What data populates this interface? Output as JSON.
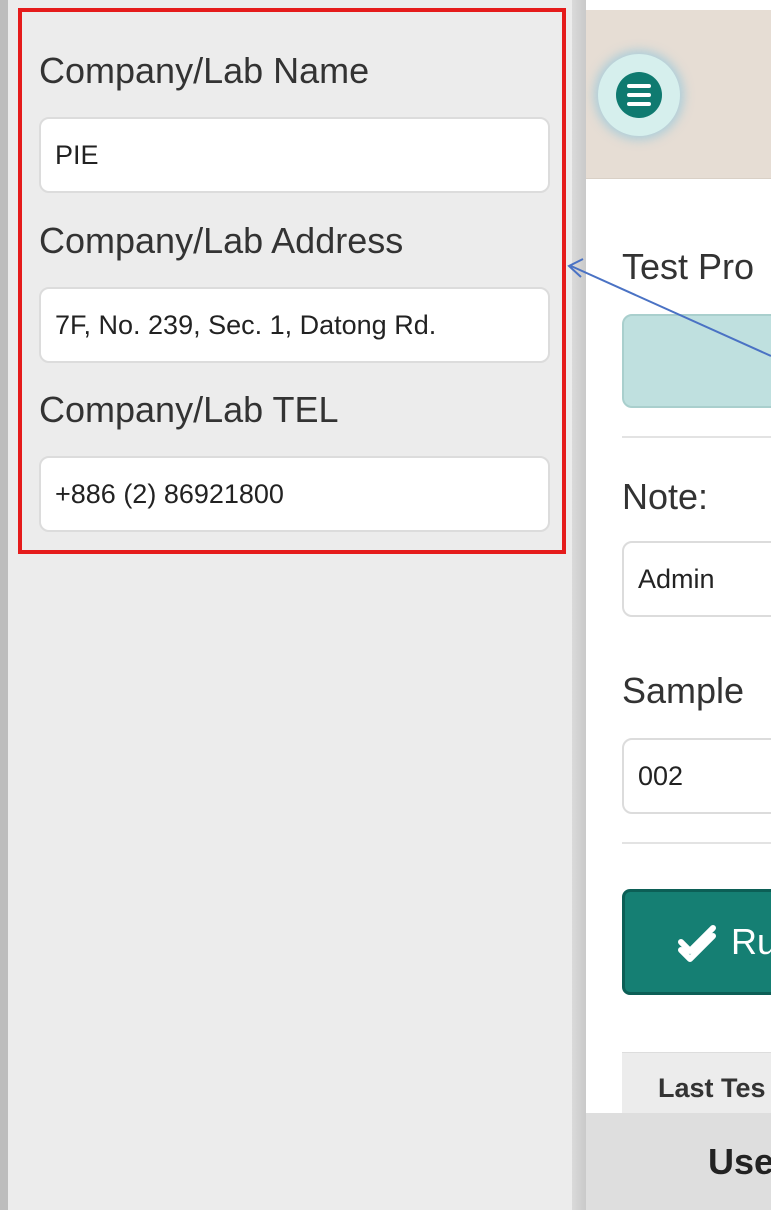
{
  "side_panel": {
    "fields": [
      {
        "label": "Company/Lab Name",
        "value": "PIE"
      },
      {
        "label": "Company/Lab Address",
        "value": "7F, No. 239, Sec. 1, Datong Rd."
      },
      {
        "label": "Company/Lab TEL",
        "value": "+886 (2) 86921800"
      }
    ]
  },
  "main": {
    "menu_icon": "hamburger-menu-icon",
    "test_profile_label": "Test Pro",
    "note_label": "Note:",
    "note_value": "Admin",
    "sample_label": "Sample",
    "sample_value": "002",
    "run_button_label": "Ru",
    "run_icon": "double-check-icon",
    "table_header": "Last Tes",
    "footer_tab_label": "Use"
  },
  "colors": {
    "highlight": "#e51b1b",
    "accent": "#157f73",
    "header_bg": "#e6ddd4",
    "arrow": "#4a72c4"
  }
}
